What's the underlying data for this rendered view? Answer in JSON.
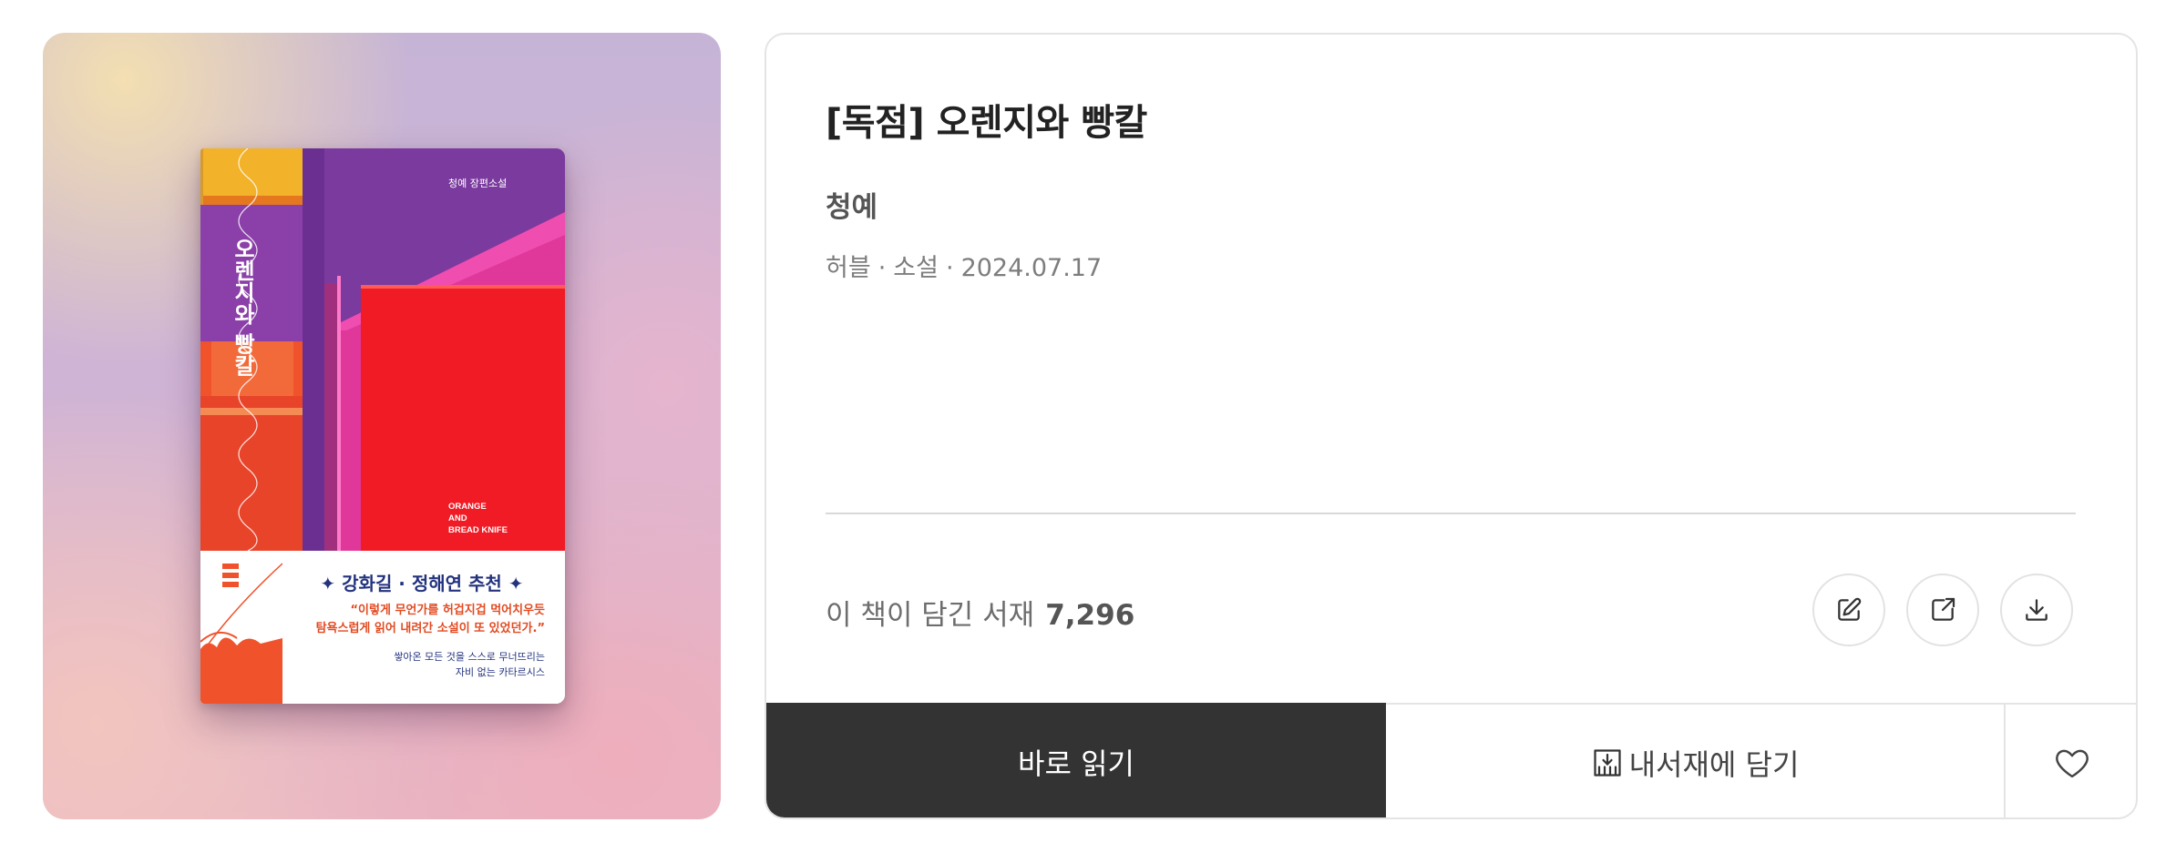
{
  "book": {
    "title": "[독점] 오렌지와 빵칼",
    "author": "청예",
    "publisher": "허블",
    "category": "소설",
    "date": "2024.07.17",
    "dot": "·"
  },
  "cover": {
    "series": "청예 장편소설",
    "title_vertical": "오렌지와 빵칼",
    "en_title": [
      "ORANGE",
      "AND",
      "BREAD KNIFE"
    ],
    "recommend": "✦ 강화길 · 정해연 추천 ✦",
    "quote": [
      "“이렇게 무언가를 허겁지겁 먹어치우듯",
      "탐욕스럽게 읽어 내려간 소설이 또 있었던가.”"
    ],
    "sub": [
      "쌓아온 모든 것을 스스로 무너뜨리는",
      "자비 없는 카타르시스"
    ]
  },
  "shelf": {
    "label": "이 책이 담긴 서재",
    "count": "7,296"
  },
  "actions": {
    "read_label": "바로 읽기",
    "add_label": "내서재에 담기"
  },
  "icons": {
    "edit": "edit-icon",
    "share": "share-icon",
    "download": "download-icon",
    "shelf_add": "shelf-add-icon",
    "like": "heart-icon"
  },
  "colors": {
    "read_button": "#333333",
    "cover_purple": "#7a3a9e",
    "cover_pink": "#e0379a",
    "cover_red": "#f01b25",
    "cover_orange": "#f0532c",
    "cover_navy": "#23337e"
  }
}
